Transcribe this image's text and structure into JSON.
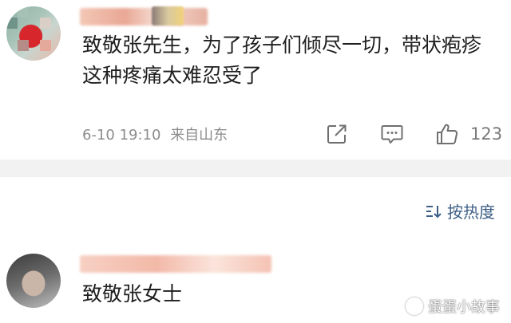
{
  "comments": [
    {
      "text": "致敬张先生，为了孩子们倾尽一切，带状疱疹这种疼痛太难忍受了",
      "date": "6-10 19:10",
      "location": "来自山东",
      "likes": "123",
      "icons": {
        "share": "share-edit-icon",
        "reply": "comment-icon",
        "like": "thumbs-up-icon"
      }
    },
    {
      "text": "致敬张女士"
    }
  ],
  "sort": {
    "label": "按热度",
    "icon": "sort-icon"
  },
  "watermark": {
    "text": "蛋蛋小故事"
  },
  "colors": {
    "link": "#3d5f86",
    "meta": "#8c8c8c",
    "divider": "#f2f2f2"
  }
}
